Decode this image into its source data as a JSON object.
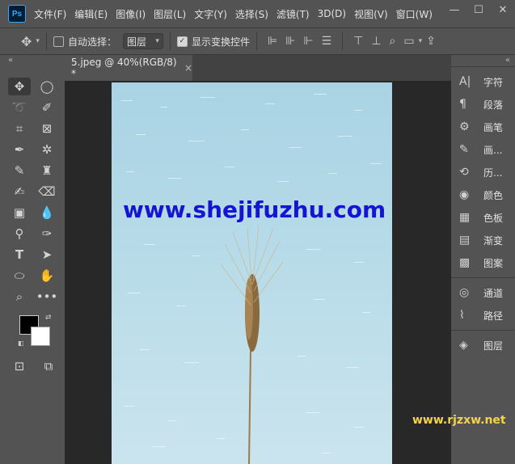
{
  "app": {
    "logo": "Ps"
  },
  "menu": [
    "文件(F)",
    "编辑(E)",
    "图像(I)",
    "图层(L)",
    "文字(Y)",
    "选择(S)",
    "滤镜(T)",
    "3D(D)",
    "视图(V)",
    "窗口(W)"
  ],
  "window_controls": {
    "minimize": "—",
    "maximize": "☐",
    "close": "✕"
  },
  "options_bar": {
    "auto_select_label": "自动选择：",
    "auto_select_checked": false,
    "auto_select_target": "图层",
    "show_transform_label": "显示变换控件",
    "show_transform_checked": true
  },
  "document": {
    "tab_title": "5.jpeg @ 40%(RGB/8) *",
    "close_glyph": "×",
    "watermark_text": "www.shejifuzhu.com"
  },
  "right_panel": {
    "groups": [
      [
        {
          "icon": "character-icon",
          "glyph": "A|",
          "label": "字符"
        },
        {
          "icon": "paragraph-icon",
          "glyph": "¶",
          "label": "段落"
        },
        {
          "icon": "brush-settings-icon",
          "glyph": "⚙",
          "label": "画笔"
        },
        {
          "icon": "brush-icon",
          "glyph": "✎",
          "label": "画..."
        },
        {
          "icon": "history-icon",
          "glyph": "⟲",
          "label": "历..."
        },
        {
          "icon": "color-icon",
          "glyph": "◉",
          "label": "颜色"
        },
        {
          "icon": "swatches-icon",
          "glyph": "▦",
          "label": "色板"
        },
        {
          "icon": "gradient-icon",
          "glyph": "▤",
          "label": "渐变"
        },
        {
          "icon": "patterns-icon",
          "glyph": "▩",
          "label": "图案"
        }
      ],
      [
        {
          "icon": "channels-icon",
          "glyph": "◎",
          "label": "通道"
        },
        {
          "icon": "paths-icon",
          "glyph": "⌇",
          "label": "路径"
        }
      ],
      [
        {
          "icon": "layers-icon",
          "glyph": "◈",
          "label": "图层"
        }
      ]
    ]
  },
  "site_watermark": "www.rjzxw.net"
}
